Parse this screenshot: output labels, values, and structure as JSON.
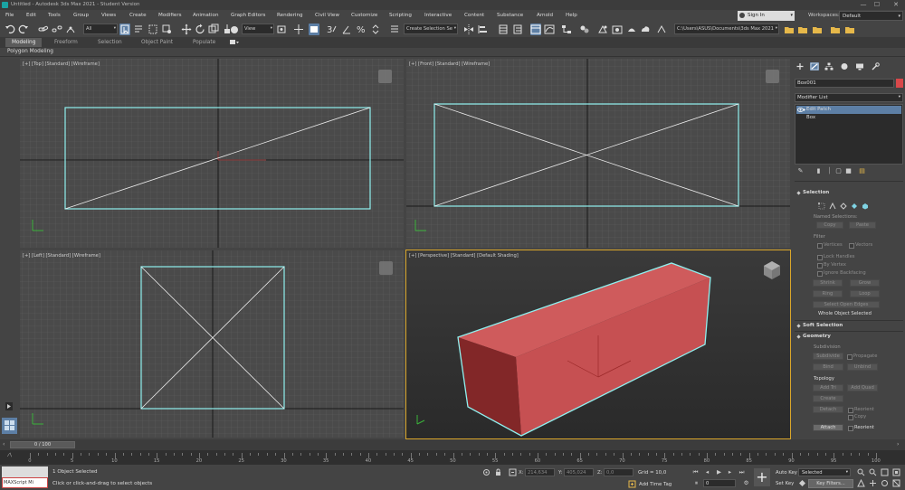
{
  "window": {
    "title": "Untitled - Autodesk 3ds Max 2021 - Student Version",
    "controls": [
      "—",
      "☐",
      "✕"
    ]
  },
  "menubar": {
    "items": [
      "File",
      "Edit",
      "Tools",
      "Group",
      "Views",
      "Create",
      "Modifiers",
      "Animation",
      "Graph Editors",
      "Rendering",
      "Civil View",
      "Customize",
      "Scripting",
      "Interactive",
      "Content",
      "Substance",
      "Arnold",
      "Help"
    ],
    "sign_in": "Sign In",
    "workspaces_label": "Workspaces:",
    "workspace_value": "Default"
  },
  "toolbar": {
    "selection_filter": "All",
    "coord_system": "View",
    "named_selection_set": "Create Selection Se",
    "project_path": "C:\\Users\\ASUS\\Documents\\3ds Max 2021"
  },
  "ribbon": {
    "tabs": [
      "Modeling",
      "Freeform",
      "Selection",
      "Object Paint",
      "Populate"
    ],
    "active_tab": "Modeling",
    "panel": "Polygon Modeling"
  },
  "viewports": {
    "top": "[+] [Top] [Standard] [Wireframe]",
    "front": "[+] [Front] [Standard] [Wireframe]",
    "left": "[+] [Left] [Standard] [Wireframe]",
    "perspective": "[+] [Perspective] [Standard] [Default Shading]"
  },
  "colors": {
    "wire_selected": "#8ff0ef",
    "box_front": "#c65052",
    "box_top": "#cf5b5c",
    "box_side": "#822728",
    "active_border": "#d9a62a",
    "accent": "#5d7fa5"
  },
  "command_panel": {
    "object_name": "Box001",
    "modifier_list": "Modifier List",
    "stack": [
      "Edit Patch",
      "Box"
    ],
    "rollouts": {
      "selection": {
        "title": "Selection",
        "named_selections_label": "Named Selections:",
        "copy": "Copy",
        "paste": "Paste",
        "filter_label": "Filter",
        "vertices": "Vertices",
        "vectors": "Vectors",
        "lock_handles": "Lock Handles",
        "by_vertex": "By Vertex",
        "ignore_backfacing": "Ignore Backfacing",
        "shrink": "Shrink",
        "grow": "Grow",
        "ring": "Ring",
        "loop": "Loop",
        "select_open_edges": "Select Open Edges",
        "status": "Whole Object Selected"
      },
      "soft_selection": {
        "title": "Soft Selection"
      },
      "geometry": {
        "title": "Geometry",
        "subdivision_label": "Subdivision",
        "subdivide": "Subdivide",
        "propagate": "Propagate",
        "bind": "Bind",
        "unbind": "Unbind",
        "topology_label": "Topology",
        "add_tri": "Add Tri",
        "add_quad": "Add Quad",
        "create": "Create",
        "detach": "Detach",
        "reorient": "Reorient",
        "copy": "Copy",
        "attach": "Attach"
      }
    }
  },
  "timeline": {
    "frame_display": "0 / 100",
    "ticks": [
      0,
      5,
      10,
      15,
      20,
      25,
      30,
      35,
      40,
      45,
      50,
      55,
      60,
      65,
      70,
      75,
      80,
      85,
      90,
      95,
      100
    ]
  },
  "status_bar": {
    "maxscript_label": "MAXScript Mi",
    "objects_selected": "1 Object Selected",
    "prompt": "Click or click-and-drag to select objects",
    "x_label": "X:",
    "x_value": "214,634",
    "y_label": "Y:",
    "y_value": "405,024",
    "z_label": "Z:",
    "z_value": "0,0",
    "grid": "Grid = 10,0",
    "add_time_tag": "Add Time Tag",
    "auto_key": "Auto Key",
    "set_key": "Set Key",
    "key_mode": "Selected",
    "key_filters": "Key Filters...",
    "current_frame": "0"
  }
}
